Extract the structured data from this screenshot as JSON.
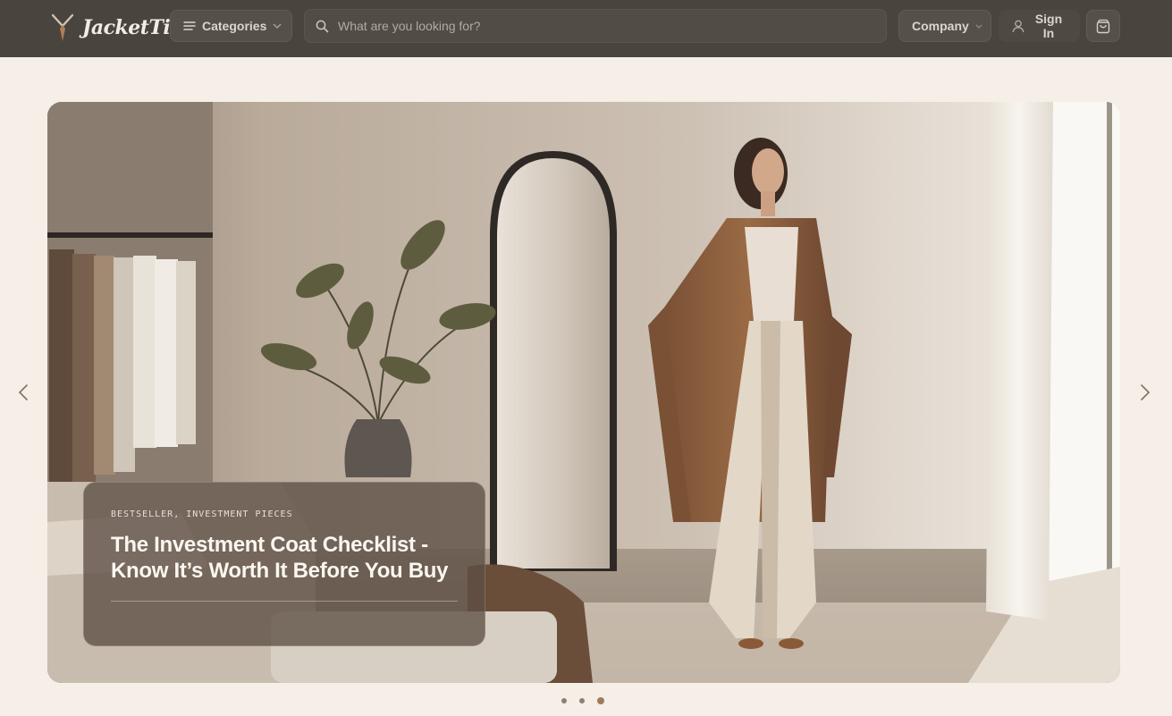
{
  "brand": {
    "name": "JacketTie"
  },
  "header": {
    "categories_label": "Categories",
    "search_placeholder": "What are you looking for?",
    "company_label": "Company",
    "signin_label": "Sign In"
  },
  "hero": {
    "slide": {
      "tags": "BESTSELLER, INVESTMENT PIECES",
      "title_line1": "The Investment Coat Checklist -",
      "title_line2": "Know It’s Worth It Before You Buy"
    },
    "carousel": {
      "total_slides": 3,
      "active_slide": 3
    }
  },
  "icons": {
    "menu": "menu-icon",
    "chevron": "chevron-down-icon",
    "search": "search-icon",
    "user": "user-icon",
    "cart": "shopping-bag-icon",
    "prev": "chevron-left-icon",
    "next": "chevron-right-icon"
  },
  "colors": {
    "header_bg": "#4a443f",
    "page_bg": "#f6efe8",
    "accent": "#a07b5c",
    "caption_bg": "#5c4e44"
  }
}
